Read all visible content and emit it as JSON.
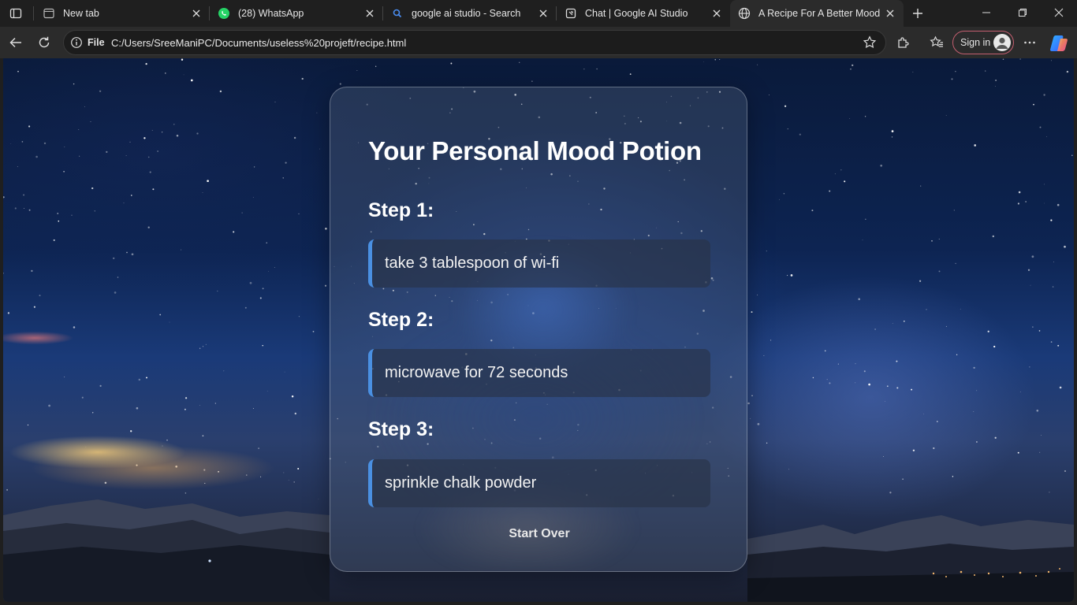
{
  "tabs": [
    {
      "title": "New tab",
      "icon": "newtab-icon"
    },
    {
      "title": "(28) WhatsApp",
      "icon": "whatsapp-icon"
    },
    {
      "title": "google ai studio - Search",
      "icon": "search-icon"
    },
    {
      "title": "Chat | Google AI Studio",
      "icon": "ai-studio-icon"
    },
    {
      "title": "A Recipe For A Better Mood",
      "icon": "globe-icon",
      "active": true
    }
  ],
  "toolbar": {
    "file_label": "File",
    "url": "C:/Users/SreeManiPC/Documents/useless%20projeft/recipe.html",
    "signin_label": "Sign in"
  },
  "page": {
    "title": "Your Personal Mood Potion",
    "steps": [
      {
        "label": "Step 1:",
        "text": "take 3 tablespoon of wi-fi"
      },
      {
        "label": "Step 2:",
        "text": "microwave for 72 seconds"
      },
      {
        "label": "Step 3:",
        "text": "sprinkle chalk powder"
      }
    ],
    "start_over_label": "Start Over"
  },
  "colors": {
    "accent": "#4a90e2",
    "signin_border": "#c45f70",
    "whatsapp": "#25d366"
  }
}
